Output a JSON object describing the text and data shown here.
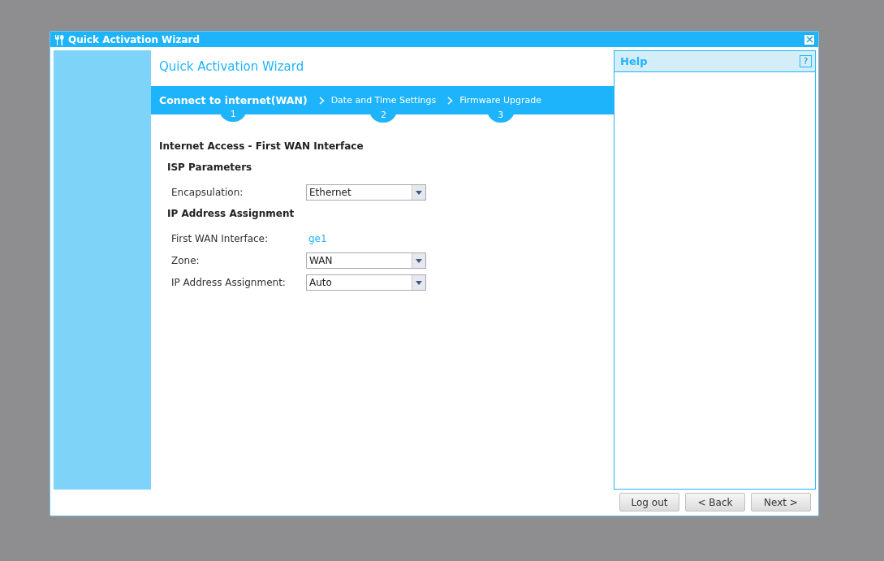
{
  "window": {
    "title": "Quick Activation Wizard"
  },
  "heading": "Quick Activation Wizard",
  "steps": [
    {
      "label": "Connect to internet(WAN)",
      "number": "1",
      "selected": true
    },
    {
      "label": "Date and Time Settings",
      "number": "2",
      "selected": false
    },
    {
      "label": "Firmware Upgrade",
      "number": "3",
      "selected": false
    }
  ],
  "section_title": "Internet Access - First WAN Interface",
  "groups": [
    {
      "title": "ISP Parameters",
      "fields": [
        {
          "kind": "select",
          "label": "Encapsulation:",
          "value": "Ethernet"
        }
      ]
    },
    {
      "title": "IP Address Assignment",
      "fields": [
        {
          "kind": "text",
          "label": "First WAN Interface:",
          "value": "ge1"
        },
        {
          "kind": "select",
          "label": "Zone:",
          "value": "WAN"
        },
        {
          "kind": "select",
          "label": "IP Address Assignment:",
          "value": "Auto"
        }
      ]
    }
  ],
  "help": {
    "title": "Help",
    "icon_text": "?"
  },
  "buttons": [
    "Log out",
    "< Back",
    "Next >"
  ]
}
